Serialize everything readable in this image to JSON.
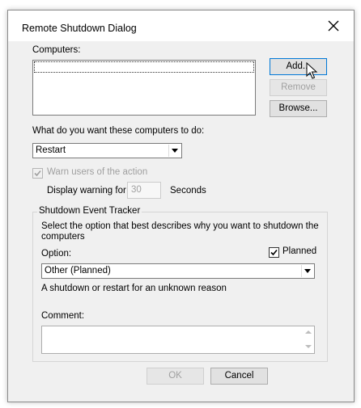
{
  "window": {
    "title": "Remote Shutdown Dialog"
  },
  "computers": {
    "label": "Computers:",
    "add_label": "Add...",
    "remove_label": "Remove",
    "browse_label": "Browse..."
  },
  "action": {
    "label": "What do you want these computers to do:",
    "selected": "Restart"
  },
  "warning": {
    "checkbox_label": "Warn users of the action",
    "checked": true,
    "display_label": "Display warning for",
    "value": "30",
    "unit": "Seconds"
  },
  "tracker": {
    "title": "Shutdown Event Tracker",
    "description": "Select the option that best describes why you want to shutdown the computers",
    "option_label": "Option:",
    "planned_label": "Planned",
    "planned_checked": true,
    "option_selected": "Other (Planned)",
    "reason": "A shutdown or restart for an unknown reason",
    "comment_label": "Comment:",
    "comment_value": ""
  },
  "footer": {
    "ok_label": "OK",
    "cancel_label": "Cancel"
  }
}
